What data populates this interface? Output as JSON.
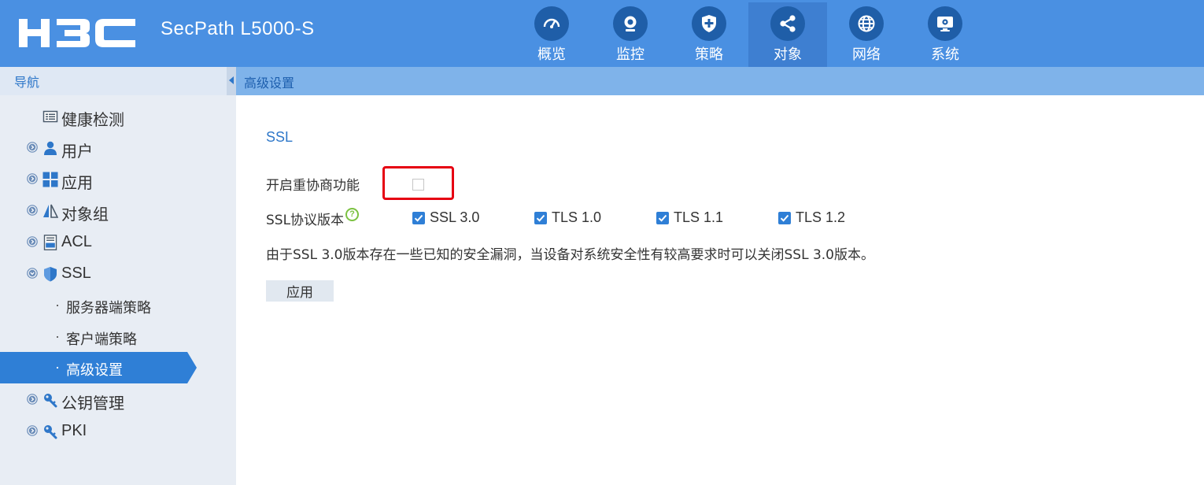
{
  "header": {
    "logo_text": "H3C",
    "product_name": "SecPath L5000-S",
    "nav": [
      {
        "label": "概览",
        "icon": "dashboard-gauge-icon",
        "active": false
      },
      {
        "label": "监控",
        "icon": "webcam-monitor-icon",
        "active": false
      },
      {
        "label": "策略",
        "icon": "shield-plus-icon",
        "active": false
      },
      {
        "label": "对象",
        "icon": "share-nodes-icon",
        "active": true
      },
      {
        "label": "网络",
        "icon": "globe-icon",
        "active": false
      },
      {
        "label": "系统",
        "icon": "computer-gear-icon",
        "active": false
      }
    ]
  },
  "sidebar": {
    "title": "导航",
    "items": [
      {
        "label": "健康检测",
        "icon": "list-icon"
      },
      {
        "label": "用户",
        "icon": "user-icon"
      },
      {
        "label": "应用",
        "icon": "grid-apps-icon"
      },
      {
        "label": "对象组",
        "icon": "triangles-icon"
      },
      {
        "label": "ACL",
        "icon": "acl-document-icon"
      },
      {
        "label": "SSL",
        "icon": "shield-icon"
      },
      {
        "label": "公钥管理",
        "icon": "key-icon"
      },
      {
        "label": "PKI",
        "icon": "key-icon"
      }
    ],
    "ssl_children": [
      {
        "label": "服务器端策略",
        "active": false
      },
      {
        "label": "客户端策略",
        "active": false
      },
      {
        "label": "高级设置",
        "active": true
      }
    ]
  },
  "content": {
    "title": "高级设置",
    "section_title": "SSL",
    "renegotiation_label": "开启重协商功能",
    "renegotiation_enabled": false,
    "protocol_label": "SSL协议版本",
    "help_symbol": "?",
    "protocols": [
      {
        "label": "SSL 3.0",
        "checked": true
      },
      {
        "label": "TLS 1.0",
        "checked": true
      },
      {
        "label": "TLS 1.1",
        "checked": true
      },
      {
        "label": "TLS 1.2",
        "checked": true
      }
    ],
    "notice": "由于SSL 3.0版本存在一些已知的安全漏洞，当设备对系统安全性有较高要求时可以关闭SSL 3.0版本。",
    "apply_label": "应用"
  },
  "colors": {
    "header_bg": "#4a90e2",
    "nav_active_bg": "#3e7fd1",
    "sidebar_selected": "#2f7fd6",
    "highlight_border": "#e60012",
    "checkbox_checked": "#2f7fd6"
  }
}
